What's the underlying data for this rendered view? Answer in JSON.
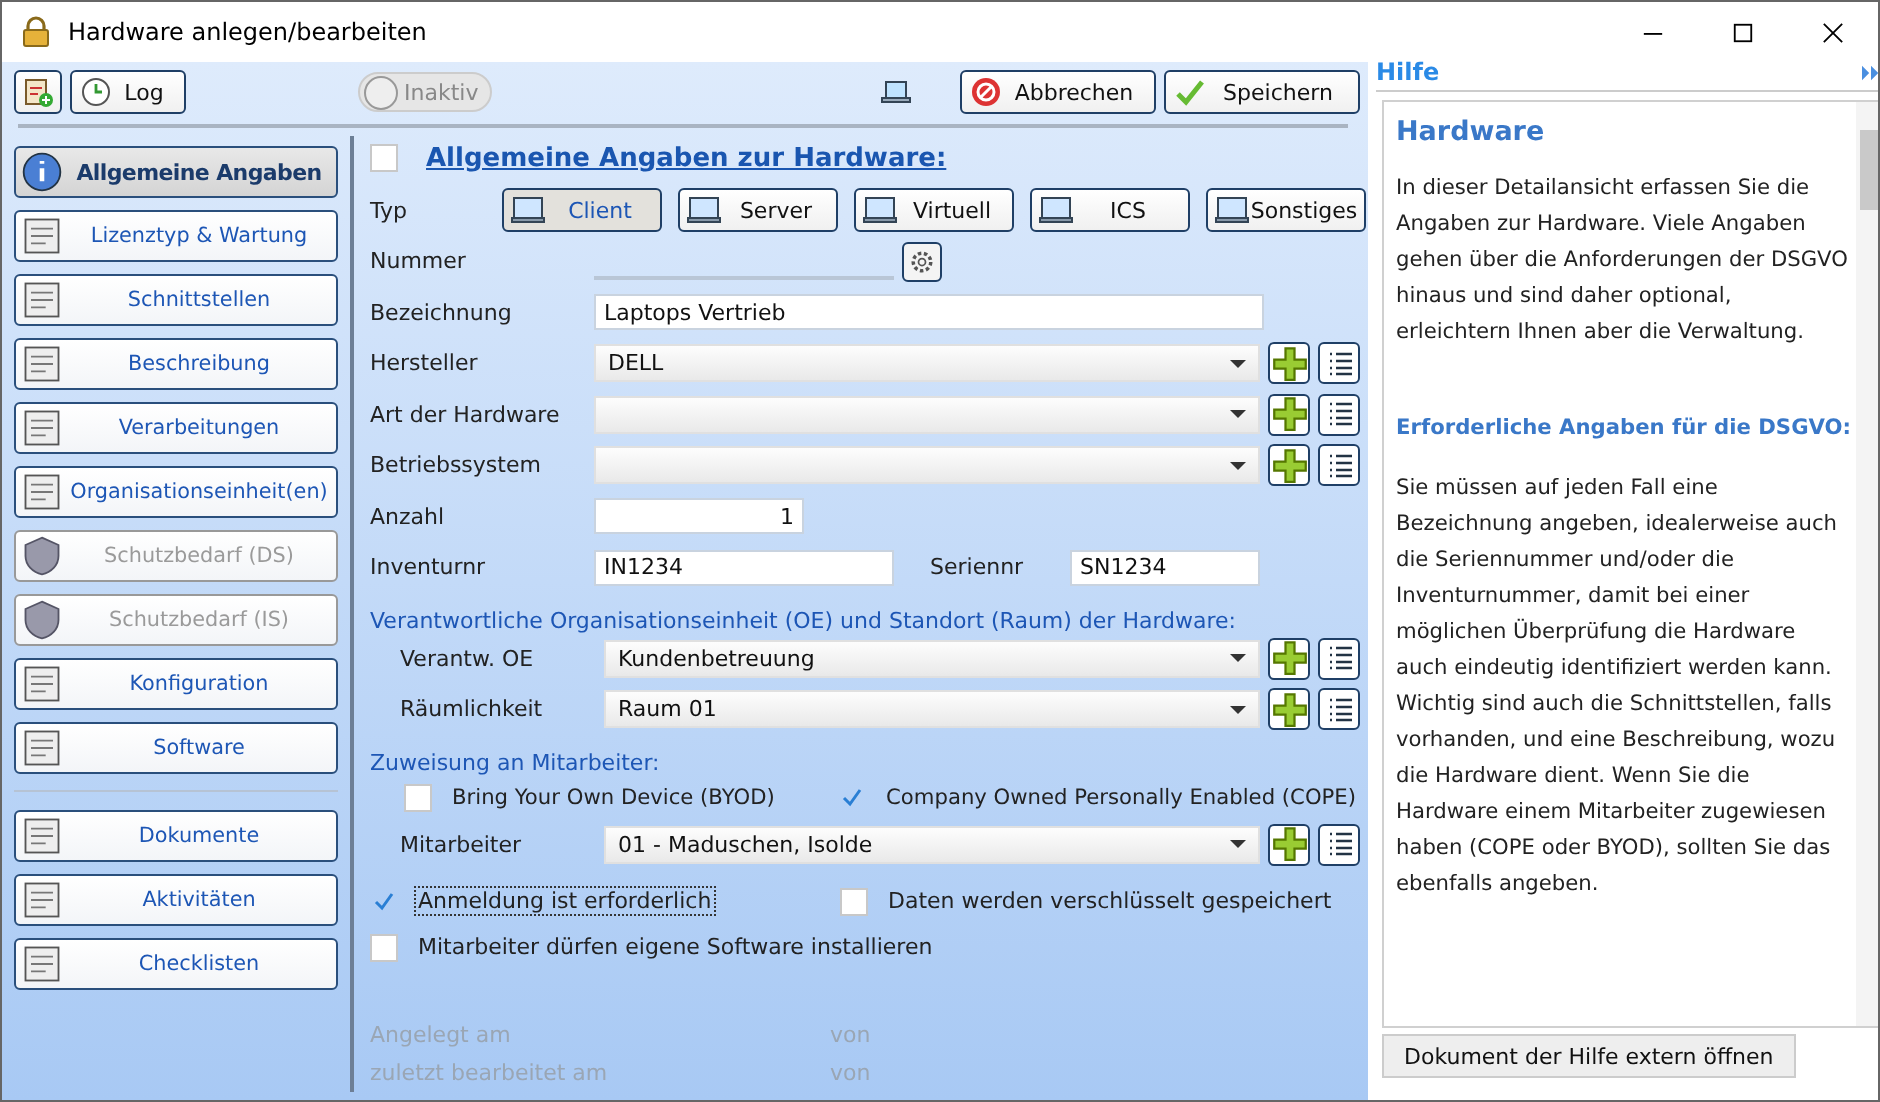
{
  "window": {
    "title": "Hardware anlegen/bearbeiten"
  },
  "toolbar": {
    "log": "Log",
    "status": {
      "label": "Inaktiv",
      "on": false
    },
    "cancel": "Abbrechen",
    "save": "Speichern"
  },
  "sidebar": {
    "items": [
      {
        "label": "Allgemeine Angaben",
        "selected": true,
        "disabled": false,
        "separator_before": false
      },
      {
        "label": "Lizenztyp & Wartung",
        "selected": false,
        "disabled": false,
        "separator_before": false
      },
      {
        "label": "Schnittstellen",
        "selected": false,
        "disabled": false,
        "separator_before": false
      },
      {
        "label": "Beschreibung",
        "selected": false,
        "disabled": false,
        "separator_before": false
      },
      {
        "label": "Verarbeitungen",
        "selected": false,
        "disabled": false,
        "separator_before": false
      },
      {
        "label": "Organisationseinheit(en)",
        "selected": false,
        "disabled": false,
        "separator_before": false
      },
      {
        "label": "Schutzbedarf (DS)",
        "selected": false,
        "disabled": true,
        "separator_before": false
      },
      {
        "label": "Schutzbedarf (IS)",
        "selected": false,
        "disabled": true,
        "separator_before": false
      },
      {
        "label": "Konfiguration",
        "selected": false,
        "disabled": false,
        "separator_before": false
      },
      {
        "label": "Software",
        "selected": false,
        "disabled": false,
        "separator_before": false
      },
      {
        "label": "Dokumente",
        "selected": false,
        "disabled": false,
        "separator_before": true
      },
      {
        "label": "Aktivitäten",
        "selected": false,
        "disabled": false,
        "separator_before": false
      },
      {
        "label": "Checklisten",
        "selected": false,
        "disabled": false,
        "separator_before": false
      }
    ]
  },
  "form": {
    "title": "Allgemeine Angaben zur Hardware:",
    "checked": false,
    "type_label": "Typ",
    "types": [
      {
        "label": "Client",
        "selected": true
      },
      {
        "label": "Server",
        "selected": false
      },
      {
        "label": "Virtuell",
        "selected": false
      },
      {
        "label": "ICS",
        "selected": false
      },
      {
        "label": "Sonstiges",
        "selected": false
      }
    ],
    "fields": [
      {
        "kind": "generated",
        "label": "Nummer"
      },
      {
        "kind": "text",
        "label": "Bezeichnung",
        "value": "Laptops Vertrieb"
      },
      {
        "kind": "select",
        "label": "Hersteller",
        "value": "DELL"
      },
      {
        "kind": "select",
        "label": "Art der Hardware"
      },
      {
        "kind": "select",
        "label": "Betriebssystem"
      },
      {
        "kind": "count",
        "label": "Anzahl",
        "value": "1"
      },
      {
        "kind": "pair",
        "label": "Inventurnr",
        "value": "IN1234",
        "label_2": "Seriennr",
        "value_2": "SN1234"
      }
    ],
    "location": {
      "title": "Verantwortliche Organisationseinheit (OE) und Standort (Raum) der Hardware:",
      "fields": [
        {
          "kind": "select",
          "label": "Verantw. OE",
          "value": "Kundenbetreuung"
        },
        {
          "kind": "select",
          "label": "Räumlichkeit",
          "value": "Raum 01"
        }
      ]
    },
    "assignment": {
      "title": "Zuweisung an Mitarbeiter:",
      "options": [
        {
          "label": "Bring Your Own Device (BYOD)",
          "checked": false
        },
        {
          "label": "Company Owned Personally Enabled (COPE)",
          "checked": true
        }
      ],
      "fields": [
        {
          "kind": "select",
          "label": "Mitarbeiter",
          "value": "01 - Maduschen, Isolde"
        }
      ]
    },
    "options": [
      {
        "label": "Anmeldung ist erforderlich",
        "checked": true,
        "focused": true
      },
      {
        "label": "Daten werden verschlüsselt gespeichert",
        "checked": false,
        "focused": false
      },
      {
        "label": "Mitarbeiter dürfen eigene Software installieren",
        "checked": false,
        "focused": false
      }
    ],
    "footer": [
      {
        "label": "Angelegt am",
        "by": "von"
      },
      {
        "label": "zuletzt bearbeitet am",
        "by": "von"
      }
    ]
  },
  "help": {
    "title": "Hilfe",
    "heading": "Hardware",
    "paragraphs": [
      {
        "kind": "text",
        "text": "In dieser Detailansicht erfassen Sie die Angaben zur Hardware. Viele Angaben gehen über die Anforderungen der DSGVO hinaus und sind daher optional, erleichtern Ihnen aber die Verwaltung."
      },
      {
        "kind": "heading",
        "text": "Erforderliche Angaben für die DSGVO:"
      },
      {
        "kind": "text",
        "text": "Sie müssen auf jeden Fall eine Bezeichnung angeben, idealerweise auch die Seriennummer und/oder die Inventurnummer, damit bei einer möglichen Überprüfung die Hardware auch eindeutig identifiziert werden kann. Wichtig sind auch die Schnittstellen, falls vorhanden, und eine Beschreibung, wozu die Hardware dient. Wenn Sie die Hardware einem Mitarbeiter zugewiesen haben (COPE oder BYOD), sollten Sie das ebenfalls angeben."
      }
    ],
    "button": "Dokument der Hilfe extern öffnen"
  }
}
